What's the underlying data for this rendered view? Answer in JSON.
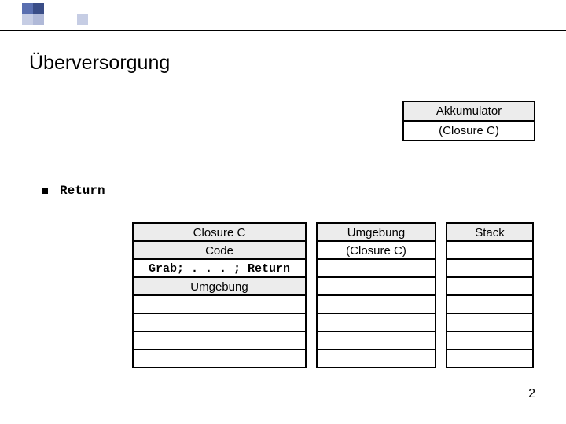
{
  "title": "Überversorgung",
  "accumulator": {
    "header": "Akkumulator",
    "value": "(Closure C)"
  },
  "bullet": {
    "label": "Return"
  },
  "tables": {
    "closure": {
      "header": "Closure C",
      "rows": [
        "Code",
        "Grab; . . . ; Return",
        "Umgebung",
        "",
        "",
        "",
        ""
      ]
    },
    "umgebung": {
      "header": "Umgebung",
      "rows": [
        "(Closure C)",
        "",
        "",
        "",
        "",
        "",
        ""
      ]
    },
    "stack": {
      "header": "Stack",
      "rows": [
        "",
        "",
        "",
        "",
        "",
        "",
        ""
      ]
    }
  },
  "page_number": "2"
}
